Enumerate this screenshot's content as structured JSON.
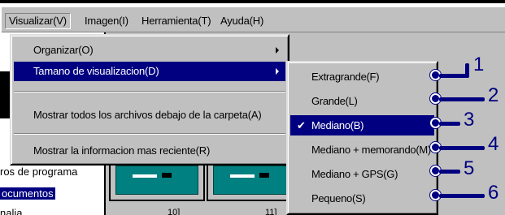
{
  "menubar": {
    "items": [
      {
        "label": "Visualizar(V)"
      },
      {
        "label": "Imagen(I)"
      },
      {
        "label": "Herramienta(T)"
      },
      {
        "label": "Ayuda(H)"
      }
    ]
  },
  "left_pane": {
    "items": [
      {
        "label": "ros de programa"
      },
      {
        "label": "ocumentos"
      },
      {
        "label": "nalia"
      }
    ]
  },
  "right_pane": {
    "thumb_labels": [
      "10]",
      "11]"
    ]
  },
  "menu": {
    "items": [
      {
        "label": "Organizar(O)"
      },
      {
        "label": "Tamano de visualizacion(D)"
      },
      {
        "label": "Mostrar todos los archivos debajo de la carpeta(A)"
      },
      {
        "label": "Mostrar la informacion mas reciente(R)"
      }
    ]
  },
  "submenu": {
    "items": [
      {
        "label": "Extragrande(F)"
      },
      {
        "label": "Grande(L)"
      },
      {
        "label": "Mediano(B)",
        "checked": true
      },
      {
        "label": "Mediano + memorando(M)"
      },
      {
        "label": "Mediano + GPS(G)"
      },
      {
        "label": "Pequeno(S)"
      }
    ],
    "check_mark": "✔"
  },
  "callouts": [
    "1",
    "2",
    "3",
    "4",
    "5",
    "6"
  ],
  "colors": {
    "highlight": "#000080",
    "menu_face": "#c0c0c0",
    "callout": "#000080"
  }
}
